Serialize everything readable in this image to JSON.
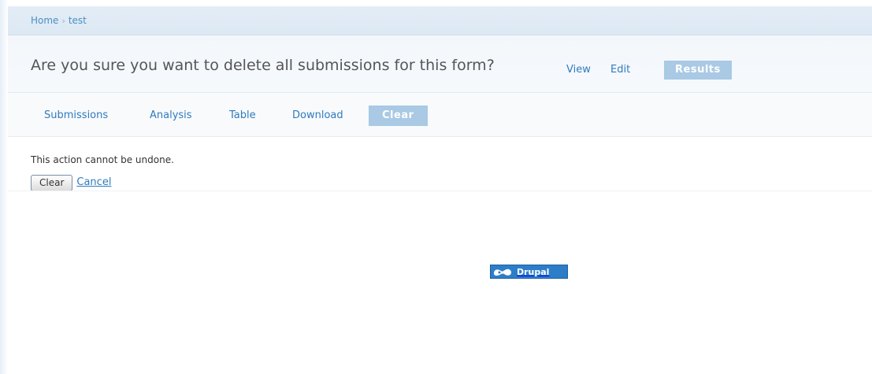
{
  "breadcrumb": {
    "home": "Home",
    "separator": "›",
    "current": "test"
  },
  "page": {
    "title": "Are you sure you want to delete all submissions for this form?"
  },
  "primary_tabs": [
    {
      "label": "View"
    },
    {
      "label": "Edit"
    },
    {
      "label": "Results",
      "active": true
    }
  ],
  "secondary_tabs": [
    {
      "label": "Submissions"
    },
    {
      "label": "Analysis"
    },
    {
      "label": "Table"
    },
    {
      "label": "Download"
    },
    {
      "label": "Clear",
      "active": true
    }
  ],
  "confirm": {
    "message": "This action cannot be undone.",
    "clear_button": "Clear",
    "cancel_link": "Cancel"
  },
  "footer": {
    "badge_text": "Drupal",
    "badge_icon": "drupal-drop-icon"
  },
  "colors": {
    "link": "#2f7bbd",
    "tab_active_bg": "#a9c9e4",
    "header_bg": "#e3edf6",
    "badge_bg": "#2c7ec9"
  }
}
